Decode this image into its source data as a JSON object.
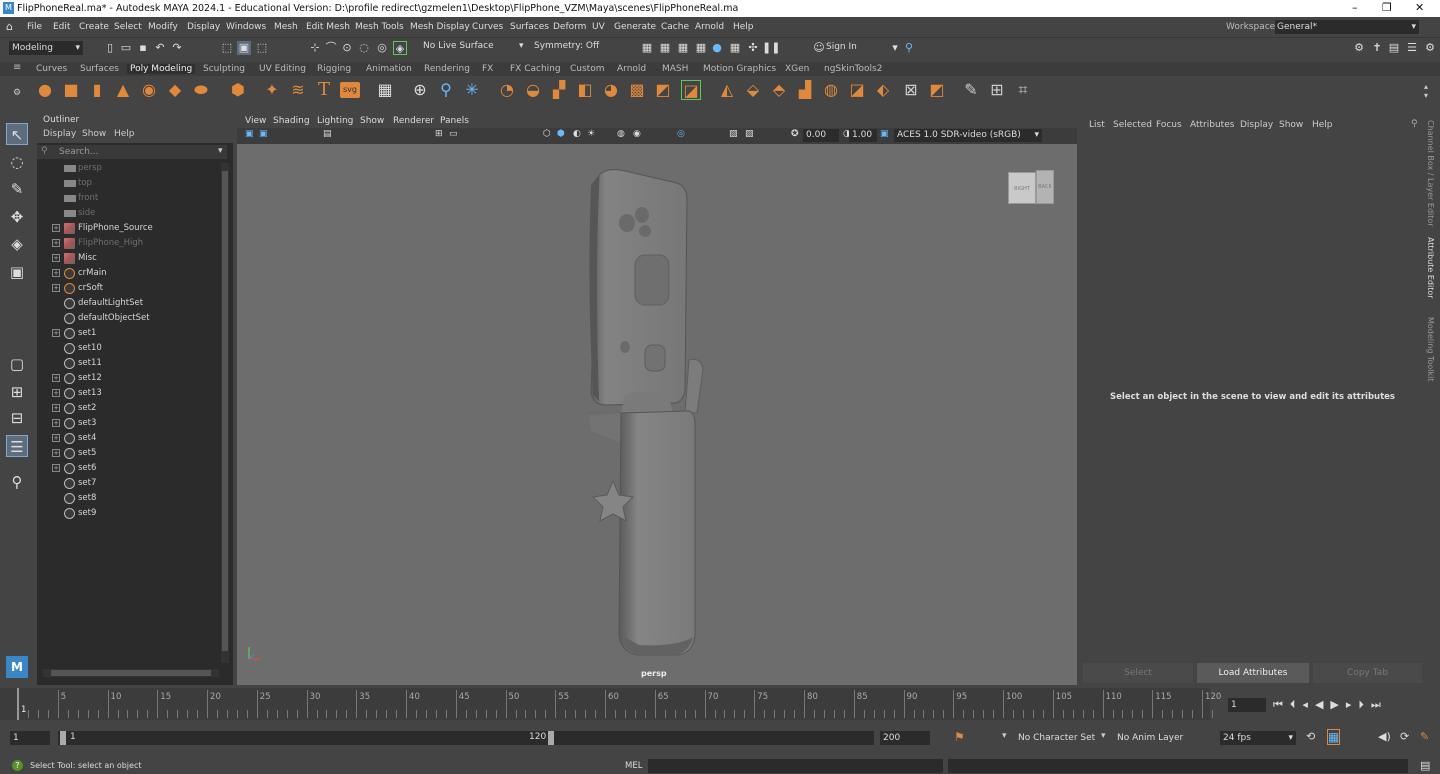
{
  "window": {
    "title": "FlipPhoneReal.ma* - Autodesk MAYA 2024.1 - Educational Version: D:\\profile redirect\\gzmelen1\\Desktop\\FlipPhone_VZM\\Maya\\scenes\\FlipPhoneReal.ma",
    "minimize": "–",
    "restore": "❐",
    "close": "✕"
  },
  "menubar": {
    "items": [
      "File",
      "Edit",
      "Create",
      "Select",
      "Modify",
      "Display",
      "Windows",
      "Mesh",
      "Edit Mesh",
      "Mesh Tools",
      "Mesh Display",
      "Curves",
      "Surfaces",
      "Deform",
      "UV",
      "Generate",
      "Cache",
      "Arnold",
      "Help"
    ],
    "workspace_label": "Workspace:",
    "workspace_value": "General*"
  },
  "statusline": {
    "menuset": "Modeling",
    "live_surface": "No Live Surface",
    "symmetry": "Symmetry: Off",
    "sign_in": "Sign In"
  },
  "shelf": {
    "tabs": [
      "Curves",
      "Surfaces",
      "Poly Modeling",
      "Sculpting",
      "UV Editing",
      "Rigging",
      "Animation",
      "Rendering",
      "FX",
      "FX Caching",
      "Custom",
      "Arnold",
      "MASH",
      "Motion Graphics",
      "XGen",
      "ngSkinTools2"
    ],
    "active_tab": "Poly Modeling",
    "svg_label": "svg",
    "text_label": "T"
  },
  "outliner": {
    "title": "Outliner",
    "menu": [
      "Display",
      "Show",
      "Help"
    ],
    "search_placeholder": "Search...",
    "items": [
      {
        "label": "persp",
        "type": "camera",
        "dim": true,
        "expand": false
      },
      {
        "label": "top",
        "type": "camera",
        "dim": true,
        "expand": false
      },
      {
        "label": "front",
        "type": "camera",
        "dim": true,
        "expand": false
      },
      {
        "label": "side",
        "type": "camera",
        "dim": true,
        "expand": false
      },
      {
        "label": "FlipPhone_Source",
        "type": "transform",
        "dim": false,
        "expand": true
      },
      {
        "label": "FlipPhone_High",
        "type": "transform",
        "dim": true,
        "expand": true
      },
      {
        "label": "Misc",
        "type": "transform",
        "dim": false,
        "expand": true
      },
      {
        "label": "crMain",
        "type": "creaseset",
        "dim": false,
        "expand": true
      },
      {
        "label": "crSoft",
        "type": "creaseset",
        "dim": false,
        "expand": true
      },
      {
        "label": "defaultLightSet",
        "type": "set",
        "dim": false,
        "expand": false
      },
      {
        "label": "defaultObjectSet",
        "type": "set",
        "dim": false,
        "expand": false
      },
      {
        "label": "set1",
        "type": "set",
        "dim": false,
        "expand": true
      },
      {
        "label": "set10",
        "type": "set",
        "dim": false,
        "expand": false
      },
      {
        "label": "set11",
        "type": "set",
        "dim": false,
        "expand": false
      },
      {
        "label": "set12",
        "type": "set",
        "dim": false,
        "expand": true
      },
      {
        "label": "set13",
        "type": "set",
        "dim": false,
        "expand": true
      },
      {
        "label": "set2",
        "type": "set",
        "dim": false,
        "expand": true
      },
      {
        "label": "set3",
        "type": "set",
        "dim": false,
        "expand": true
      },
      {
        "label": "set4",
        "type": "set",
        "dim": false,
        "expand": true
      },
      {
        "label": "set5",
        "type": "set",
        "dim": false,
        "expand": true
      },
      {
        "label": "set6",
        "type": "set",
        "dim": false,
        "expand": true
      },
      {
        "label": "set7",
        "type": "set",
        "dim": false,
        "expand": false
      },
      {
        "label": "set8",
        "type": "set",
        "dim": false,
        "expand": false
      },
      {
        "label": "set9",
        "type": "set",
        "dim": false,
        "expand": false
      }
    ]
  },
  "viewport": {
    "menu": [
      "View",
      "Shading",
      "Lighting",
      "Show",
      "Renderer",
      "Panels"
    ],
    "gamma_value": "0.00",
    "exposure_value": "1.00",
    "color_space": "ACES 1.0 SDR-video (sRGB)",
    "camera_label": "persp",
    "viewcube_right": "RIGHT",
    "viewcube_back": "BACK"
  },
  "attribute_editor": {
    "menu": [
      "List",
      "Selected",
      "Focus",
      "Attributes",
      "Display",
      "Show",
      "Help"
    ],
    "message": "Select an object in the scene to view and edit its attributes",
    "buttons": {
      "select": "Select",
      "load": "Load Attributes",
      "copy": "Copy Tab"
    }
  },
  "sidebar_tabs": [
    "Channel Box / Layer Editor",
    "Attribute Editor",
    "Modeling Toolkit"
  ],
  "timeslider": {
    "tick_labels": [
      "5",
      "10",
      "15",
      "20",
      "25",
      "30",
      "35",
      "40",
      "45",
      "50",
      "55",
      "60",
      "65",
      "70",
      "75",
      "80",
      "85",
      "90",
      "95",
      "100",
      "105",
      "110",
      "115",
      "120"
    ],
    "start_label": "1",
    "current_frame": "1"
  },
  "range": {
    "start": "1",
    "inner_start": "1",
    "inner_end": "120",
    "end": "200",
    "character_set": "No Character Set",
    "anim_layer": "No Anim Layer",
    "fps": "24 fps"
  },
  "helpline": {
    "message": "Select Tool: select an object",
    "mel_label": "MEL"
  }
}
